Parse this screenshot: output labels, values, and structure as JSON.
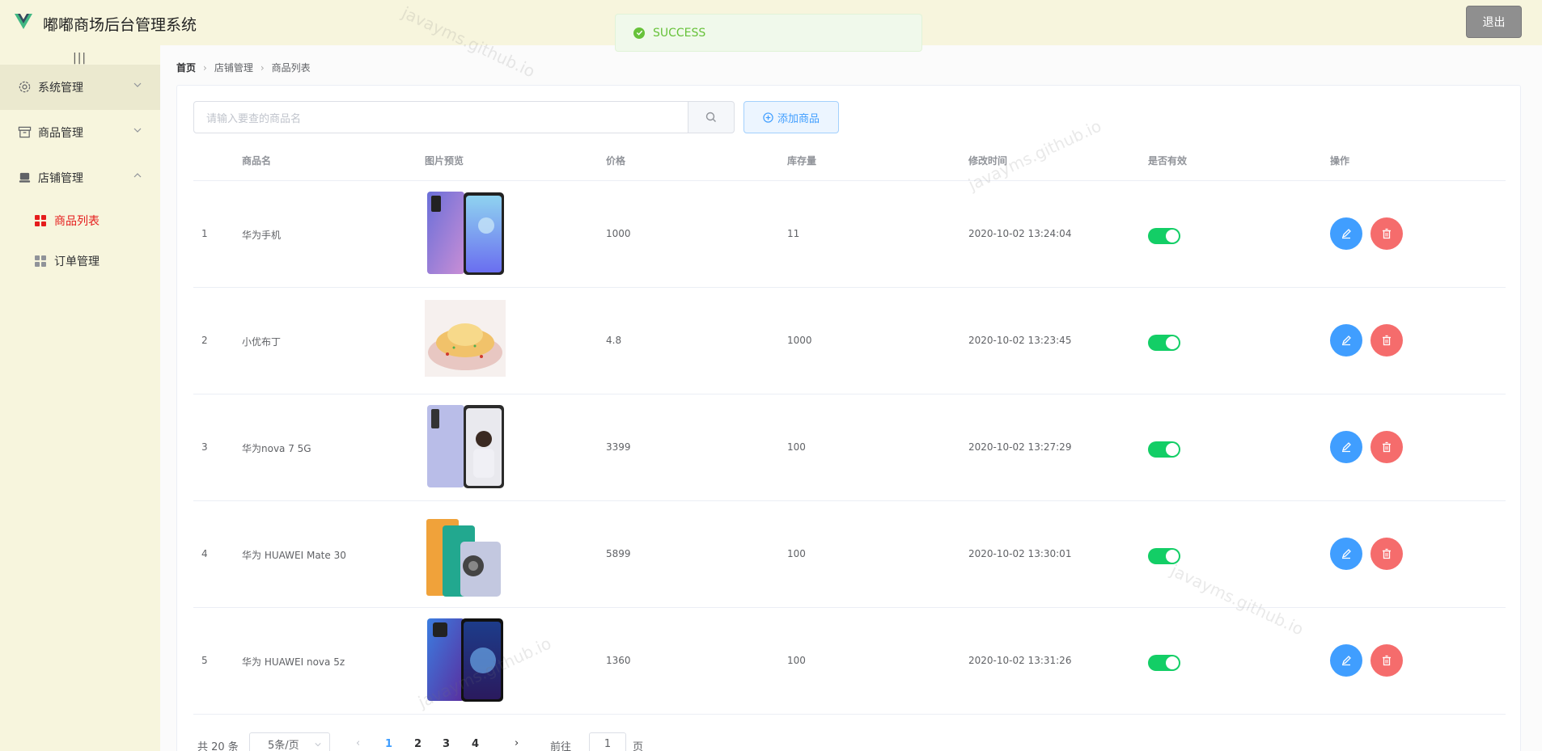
{
  "header": {
    "title": "嘟嘟商场后台管理系统",
    "logout_label": "退出"
  },
  "sidebar": {
    "collapse_glyph": "|||",
    "groups": [
      {
        "label": "系统管理",
        "icon": "gear-icon"
      },
      {
        "label": "商品管理",
        "icon": "box-icon"
      },
      {
        "label": "店铺管理",
        "icon": "shop-icon"
      }
    ],
    "sub_items": [
      {
        "label": "商品列表",
        "active": true
      },
      {
        "label": "订单管理",
        "active": false
      }
    ]
  },
  "breadcrumb": [
    "首页",
    "店铺管理",
    "商品列表"
  ],
  "search": {
    "placeholder": "请输入要查的商品名"
  },
  "add_button_label": "添加商品",
  "table": {
    "headers": [
      "商品名",
      "图片预览",
      "价格",
      "库存量",
      "修改时间",
      "是否有效",
      "操作"
    ],
    "rows": [
      {
        "index": "1",
        "name": "华为手机",
        "price": "1000",
        "stock": "11",
        "modified": "2020-10-02 13:24:04",
        "active": true
      },
      {
        "index": "2",
        "name": "小优布丁",
        "price": "4.8",
        "stock": "1000",
        "modified": "2020-10-02 13:23:45",
        "active": true
      },
      {
        "index": "3",
        "name": "华为nova 7 5G",
        "price": "3399",
        "stock": "100",
        "modified": "2020-10-02 13:27:29",
        "active": true
      },
      {
        "index": "4",
        "name": "华为 HUAWEI Mate 30",
        "price": "5899",
        "stock": "100",
        "modified": "2020-10-02 13:30:01",
        "active": true
      },
      {
        "index": "5",
        "name": "华为 HUAWEI nova 5z",
        "price": "1360",
        "stock": "100",
        "modified": "2020-10-02 13:31:26",
        "active": true
      }
    ]
  },
  "pagination": {
    "total": "共 20 条",
    "page_size": "5条/页",
    "pages": [
      "1",
      "2",
      "3",
      "4"
    ],
    "current": "1",
    "goto_label": "前往",
    "goto_value": "1",
    "page_label": "页"
  },
  "toast": {
    "message": "SUCCESS"
  },
  "watermark": "javayms.github.io",
  "colors": {
    "primary": "#409eff",
    "danger": "#f56c6c",
    "success": "#13ce66",
    "active_menu": "#e51c1c",
    "background": "#f7f5dd"
  }
}
